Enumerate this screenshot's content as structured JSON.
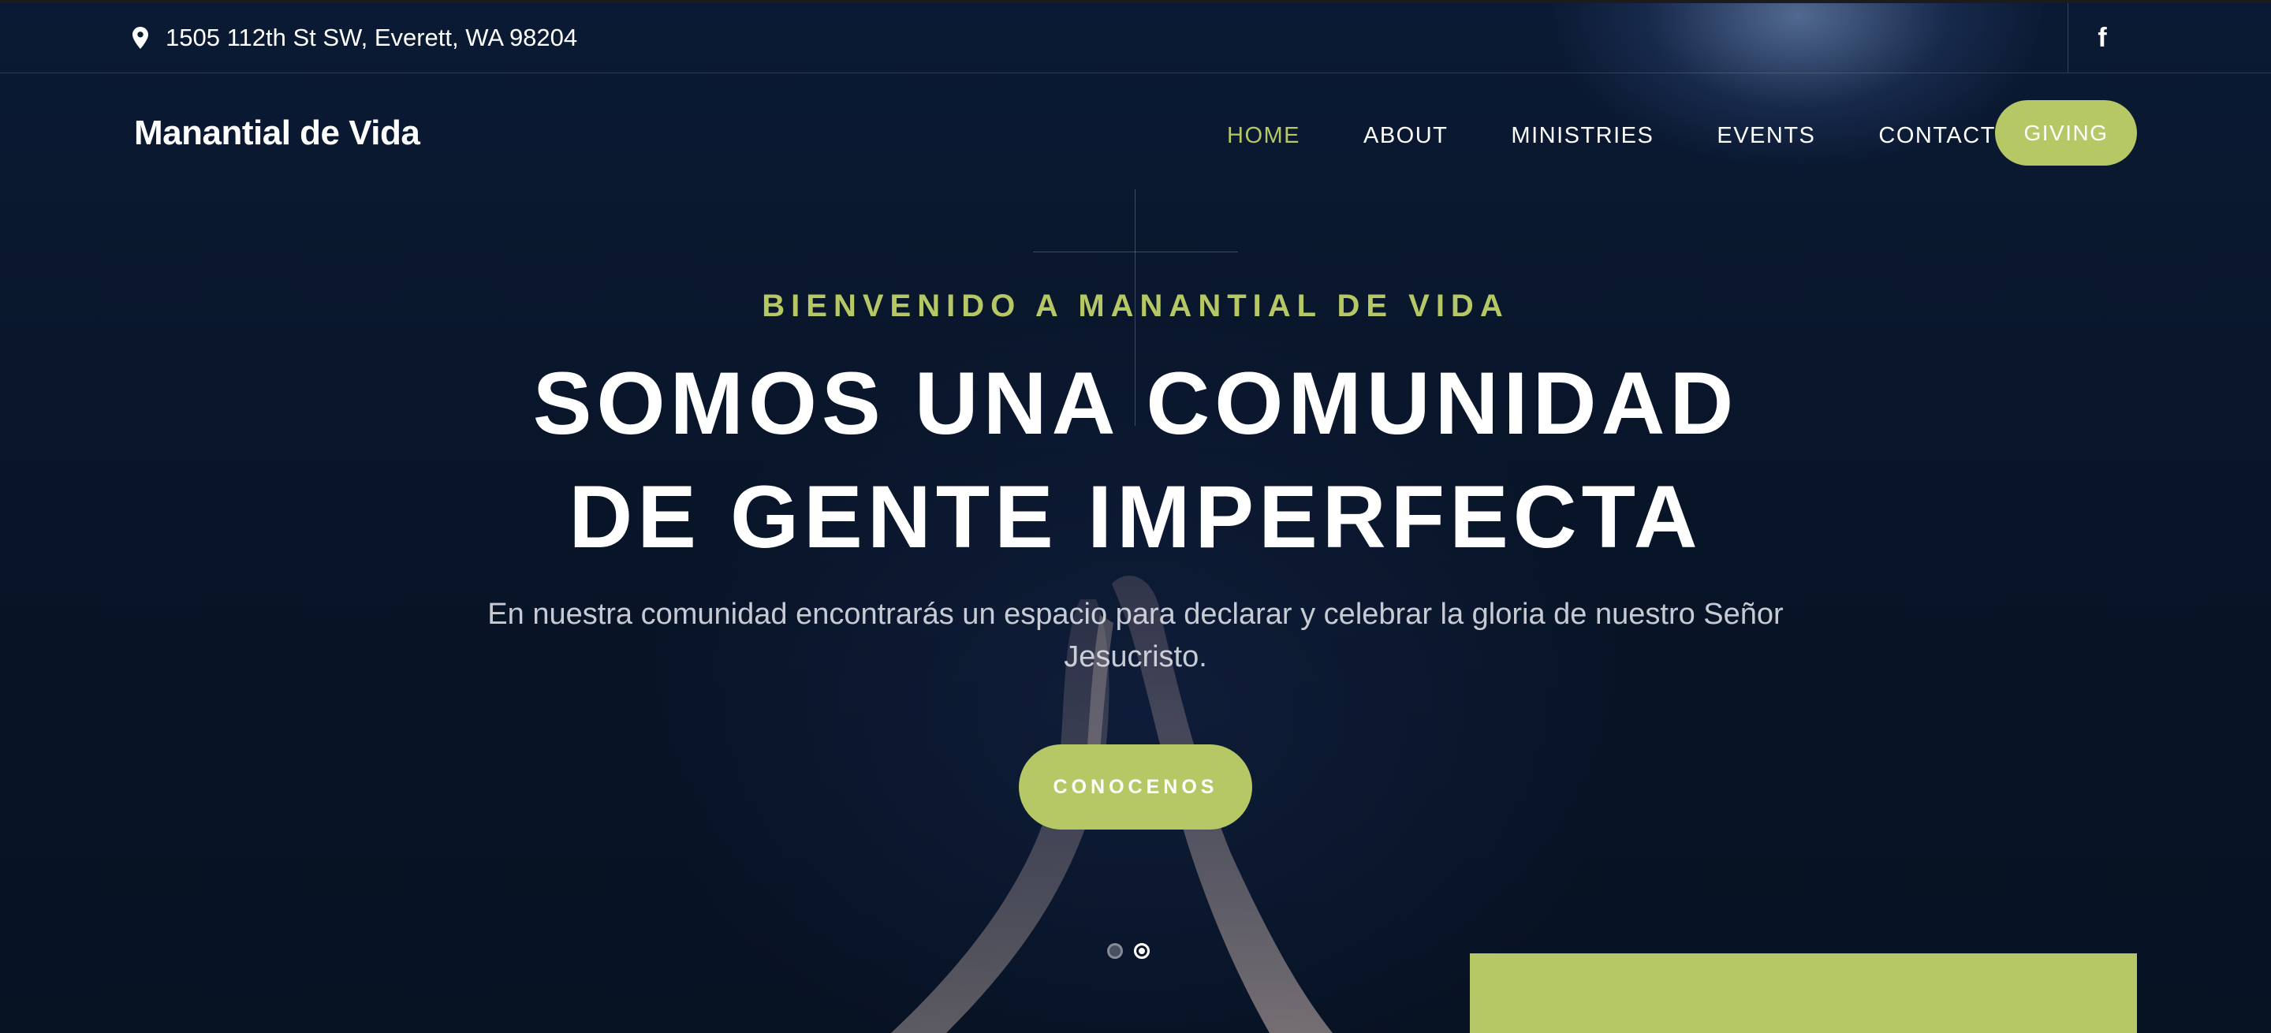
{
  "topbar": {
    "address": "1505 112th St SW, Everett, WA 98204",
    "address_icon": "map-pin-icon",
    "social_icon": "facebook-icon",
    "social_glyph": "f"
  },
  "header": {
    "logo": "Manantial de Vida",
    "nav": [
      {
        "label": "HOME",
        "active": true
      },
      {
        "label": "ABOUT",
        "active": false
      },
      {
        "label": "MINISTRIES",
        "active": false
      },
      {
        "label": "EVENTS",
        "active": false
      },
      {
        "label": "CONTACT",
        "active": false
      }
    ],
    "giving_label": "GIVING"
  },
  "hero": {
    "eyebrow": "BIENVENIDO A MANANTIAL DE VIDA",
    "headline_line1": "SOMOS UNA COMUNIDAD",
    "headline_line2": "DE GENTE IMPERFECTA",
    "subtext": "En nuestra comunidad encontrarás un espacio para declarar y celebrar la gloria de nuestro Señor Jesucristo.",
    "cta_label": "CONOCENOS",
    "slides": {
      "count": 2,
      "active_index": 1
    }
  },
  "colors": {
    "accent": "#b5c865",
    "background": "#0a1528",
    "text": "#ffffff"
  }
}
